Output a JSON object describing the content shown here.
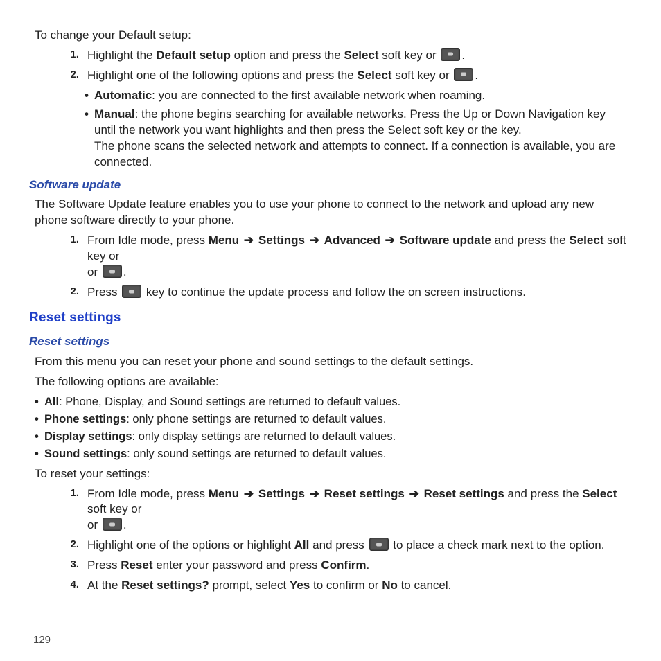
{
  "pageNumber": "129",
  "intro": "To change your Default setup:",
  "step1": {
    "num": "1.",
    "t1": "Highlight the ",
    "b1": "Default setup",
    "t2": " option and press the ",
    "b2": "Select",
    "t3": " soft key or ",
    "t4": "."
  },
  "step2": {
    "num": "2.",
    "t1": "Highlight one of the following options and press the ",
    "b1": "Select",
    "t2": " soft key or ",
    "t3": "."
  },
  "opts": {
    "auto": {
      "b": "Automatic",
      "t": ": you are connected to the first available network when roaming."
    },
    "man": {
      "b": "Manual",
      "t1": ": the phone begins searching for available networks. Press the Up or Down Navigation key until the network you want highlights and then press the Select soft key or the key.",
      "t2": "The phone scans the selected network and attempts to connect. If a connection is available, you are connected."
    }
  },
  "swHeading": "Software update",
  "swPara": "The Software Update feature enables you to use your phone to connect to the network and upload any new phone software directly to your phone.",
  "sw1": {
    "num": "1.",
    "t1": "From Idle mode, press ",
    "b1": "Menu",
    "a": "➔",
    "b2": "Settings",
    "b3": "Advanced",
    "b4": "Software update",
    "t2": " and press the ",
    "b5": "Select",
    "t3": " soft key or ",
    "t4": "."
  },
  "sw2": {
    "num": "2.",
    "t1": "Press ",
    "t2": " key to continue the update process and follow the on screen instructions."
  },
  "rsMain": "Reset settings",
  "rsSub": "Reset settings",
  "rsPara1": "From this menu you can reset your phone and sound settings to the default settings.",
  "rsPara2": "The following options are available:",
  "rsOpts": {
    "all": {
      "b": "All",
      "t": ": Phone, Display, and Sound settings are returned to default values."
    },
    "phn": {
      "b": "Phone settings",
      "t": ": only phone settings are returned to default values."
    },
    "disp": {
      "b": "Display settings",
      "t": ": only display settings are returned to default values."
    },
    "snd": {
      "b": "Sound settings",
      "t": ": only sound settings are returned to default values."
    }
  },
  "rsPara3": "To reset your settings:",
  "rs1": {
    "num": "1.",
    "t1": "From Idle mode, press ",
    "b1": "Menu",
    "a": "➔",
    "b2": "Settings",
    "b3": "Reset settings",
    "b4": "Reset settings",
    "t2": " and press the ",
    "b5": "Select",
    "t3": " soft key or ",
    "t4": "."
  },
  "rs2": {
    "num": "2.",
    "t1": "Highlight one of the options or highlight ",
    "b1": "All",
    "t2": " and press ",
    "t3": " to place a check mark next to the option."
  },
  "rs3": {
    "num": "3.",
    "t1": "Press ",
    "b1": "Reset",
    "t2": " enter your password and press ",
    "b2": "Confirm",
    "t3": "."
  },
  "rs4": {
    "num": "4.",
    "t1": "At the ",
    "b1": "Reset settings?",
    "t2": " prompt, select ",
    "b2": "Yes",
    "t3": " to confirm or ",
    "b3": "No",
    "t4": " to cancel."
  }
}
